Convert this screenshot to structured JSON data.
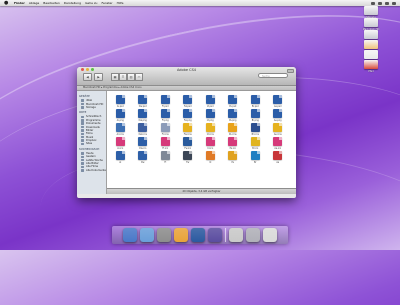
{
  "menubar": {
    "app_name": "Finder",
    "items": [
      "Ablage",
      "Bearbeiten",
      "Darstellung",
      "Gehe zu",
      "Fenster",
      "Hilfe"
    ]
  },
  "desktop_icons": [
    {
      "label": "Storage",
      "color": "#c9c9d3"
    },
    {
      "label": "Macintosh HD",
      "color": "#c9c9d3"
    },
    {
      "label": "Share",
      "color": "#c9c9d3"
    },
    {
      "label": "Lexicon",
      "color": "#f0c27a"
    },
    {
      "label": "Script",
      "color": "#e9e9e9"
    },
    {
      "label": "Pfad",
      "color": "#d84b3d"
    }
  ],
  "window": {
    "title": "Adobe CS4",
    "path": "Macintosh HD ▸ Programme ▸ Adobe CS4 Icons",
    "search_placeholder": "Suche",
    "status": "40 Objekte, 3,4 GB verfügbar",
    "sidebar": [
      {
        "heading": "GERÄTE",
        "items": [
          "iDisk",
          "Macintosh HD",
          "Storage"
        ]
      },
      {
        "heading": "ORTE",
        "items": [
          "Schreibtisch",
          "Programme",
          "Dokumente",
          "Downloads",
          "Bilder",
          "Filme",
          "Musik",
          "Dropbox",
          "Sites"
        ]
      },
      {
        "heading": "SUCHEN NACH",
        "items": [
          "Heute",
          "Gestern",
          "Letzte Woche",
          "Alle Bilder",
          "Alle Filme",
          "Alle Dokumente"
        ]
      }
    ],
    "files": [
      {
        "name": "Ai.psd",
        "color": "#2b5da8"
      },
      {
        "name": "Dw.psd",
        "color": "#2b5da8"
      },
      {
        "name": "Fl.psd",
        "color": "#2b5da8"
      },
      {
        "name": "Fw.psd",
        "color": "#2b5da8"
      },
      {
        "name": "Id.psd",
        "color": "#2b5da8"
      },
      {
        "name": "Ps.psd",
        "color": "#2b5da8"
      },
      {
        "name": "Br.psd",
        "color": "#2b5da8"
      },
      {
        "name": "Ae.psd",
        "color": "#2b5da8"
      },
      {
        "name": "Ai.png",
        "color": "#2b5da8"
      },
      {
        "name": "Dw.png",
        "color": "#2b5da8"
      },
      {
        "name": "Fl.png",
        "color": "#2b5da8"
      },
      {
        "name": "Fw.png",
        "color": "#2b5da8"
      },
      {
        "name": "Id.png",
        "color": "#2b5da8"
      },
      {
        "name": "Ps.png",
        "color": "#2b5da8"
      },
      {
        "name": "Br.png",
        "color": "#2b5da8"
      },
      {
        "name": "Ae.png",
        "color": "#2b5da8"
      },
      {
        "name": "Ai.icns",
        "color": "#3c6fb3"
      },
      {
        "name": "Dw.icns",
        "color": "#3d5fa0"
      },
      {
        "name": "Fl.icns",
        "color": "#8c9bb8"
      },
      {
        "name": "Fw.icns",
        "color": "#e6b21f"
      },
      {
        "name": "Id.icns",
        "color": "#e6b21f"
      },
      {
        "name": "Ps.icns",
        "color": "#e8a21a"
      },
      {
        "name": "Br.icns",
        "color": "#2d4f8f"
      },
      {
        "name": "Ae.icns",
        "color": "#e6b21f"
      },
      {
        "name": "Ai.ico",
        "color": "#d63a7a"
      },
      {
        "name": "Dw.ico",
        "color": "#2d5fa8"
      },
      {
        "name": "Fl.ico",
        "color": "#d63a7a"
      },
      {
        "name": "Fw.ico",
        "color": "#2a5b9c"
      },
      {
        "name": "Id.ico",
        "color": "#d63a7a"
      },
      {
        "name": "Ps.ico",
        "color": "#d63a7a"
      },
      {
        "name": "Br.ico",
        "color": "#e0b41f"
      },
      {
        "name": "Ae.ico",
        "color": "#d63a7a"
      },
      {
        "name": "Ai",
        "color": "#2d5fa8"
      },
      {
        "name": "Dw",
        "color": "#2d5fa8"
      },
      {
        "name": "Fl",
        "color": "#7f8896"
      },
      {
        "name": "Fw",
        "color": "#3c4656"
      },
      {
        "name": "Id",
        "color": "#e07a26"
      },
      {
        "name": "Ps",
        "color": "#e0a21f"
      },
      {
        "name": "Br",
        "color": "#1f7fc2"
      },
      {
        "name": "Ae",
        "color": "#c8363a"
      }
    ]
  },
  "dock": [
    {
      "name": "Finder",
      "color": "#4a78c8"
    },
    {
      "name": "Safari",
      "color": "#6a9fd9"
    },
    {
      "name": "Mail",
      "color": "#8d8d8d"
    },
    {
      "name": "Systemeinstellungen",
      "color": "#e8a33a"
    },
    {
      "name": "iTunes",
      "color": "#2c5aa0"
    },
    {
      "name": "Vorschau",
      "color": "#5b4da0"
    },
    {
      "name": "Programme",
      "color": "#c9c9c9"
    },
    {
      "name": "Dokumente",
      "color": "#b0b0b8"
    },
    {
      "name": "Papierkorb",
      "color": "#d9d9d9"
    }
  ]
}
